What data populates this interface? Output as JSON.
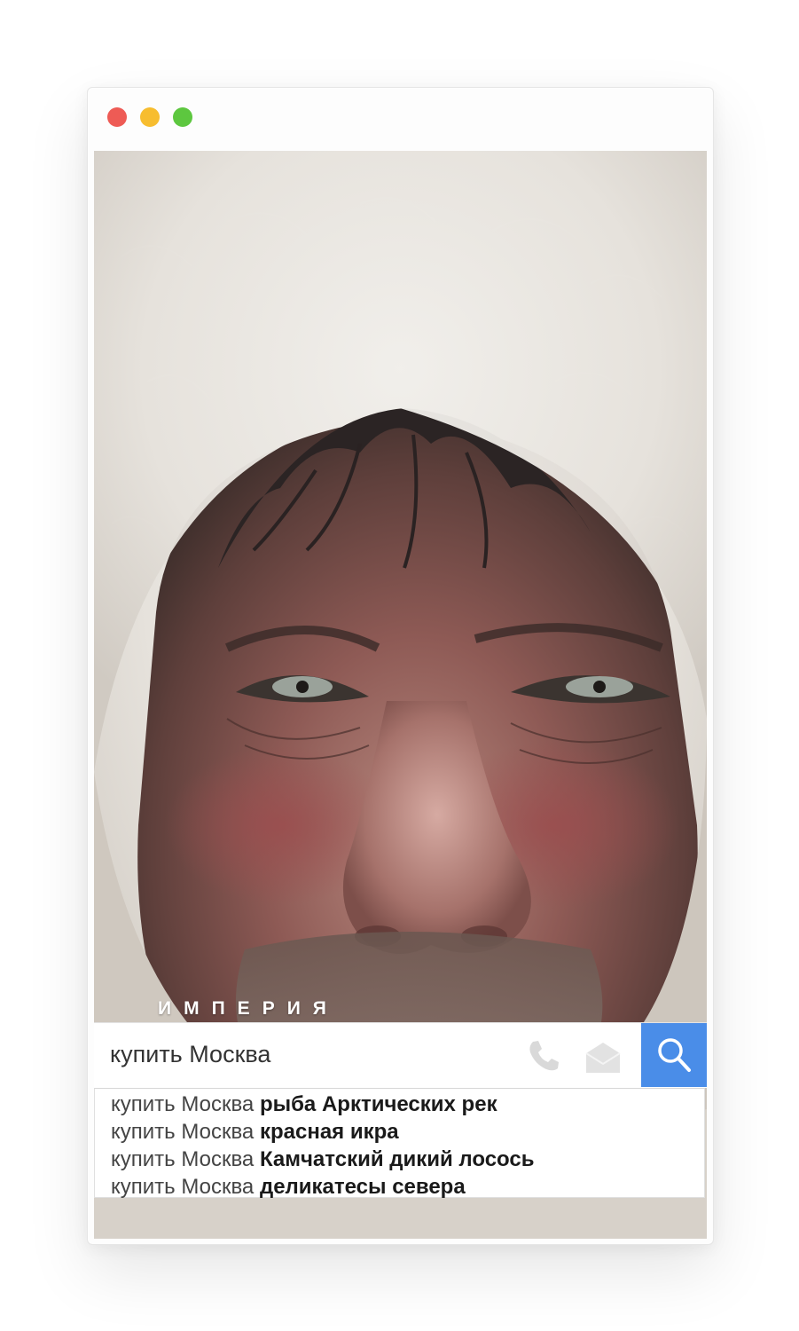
{
  "window": {
    "buttons": [
      {
        "name": "close",
        "color": "#ee5b55"
      },
      {
        "name": "minimize",
        "color": "#f7bd2f"
      },
      {
        "name": "maximize",
        "color": "#5dc73f"
      }
    ]
  },
  "hero": {
    "brand_text": "ИМПЕРИЯ"
  },
  "search": {
    "value": "купить Москва",
    "phone_icon": "phone-icon",
    "mail_icon": "mail-icon",
    "button_icon": "search-icon",
    "button_color": "#4a8de8"
  },
  "suggestions": [
    {
      "prefix": "купить Москва",
      "completion": "рыба Арктических рек"
    },
    {
      "prefix": "купить Москва",
      "completion": "красная икра"
    },
    {
      "prefix": "купить Москва",
      "completion": "Камчатский дикий лосось"
    },
    {
      "prefix": "купить Москва",
      "completion": "деликатесы севера"
    }
  ]
}
